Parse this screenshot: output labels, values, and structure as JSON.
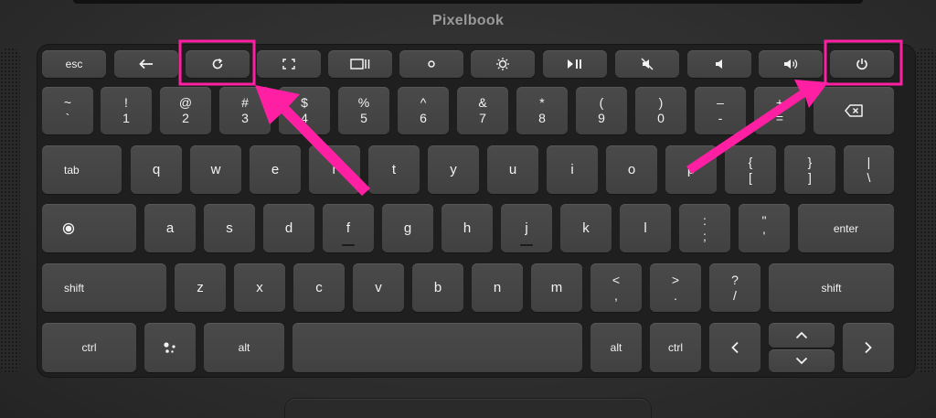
{
  "brand": "Pixelbook",
  "accent_color": "#ff1fa3",
  "icons": {
    "back": "arrow-left-icon",
    "refresh": "refresh-icon",
    "fullscreen": "fullscreen-icon",
    "overview": "window-overview-icon",
    "brightness_down": "brightness-down-icon",
    "brightness_up": "brightness-up-icon",
    "play_pause": "play-pause-icon",
    "mute": "mute-icon",
    "volume_down": "volume-down-icon",
    "volume_up": "volume-up-icon",
    "power": "power-icon",
    "backspace": "backspace-icon",
    "launcher": "launcher-icon",
    "assistant": "assistant-icon"
  },
  "keys": {
    "esc": "esc",
    "tab": "tab",
    "enter": "enter",
    "shift": "shift",
    "ctrl": "ctrl",
    "alt": "alt",
    "number_row": [
      {
        "top": "~",
        "bottom": "`"
      },
      {
        "top": "!",
        "bottom": "1"
      },
      {
        "top": "@",
        "bottom": "2"
      },
      {
        "top": "#",
        "bottom": "3"
      },
      {
        "top": "$",
        "bottom": "4"
      },
      {
        "top": "%",
        "bottom": "5"
      },
      {
        "top": "^",
        "bottom": "6"
      },
      {
        "top": "&",
        "bottom": "7"
      },
      {
        "top": "*",
        "bottom": "8"
      },
      {
        "top": "(",
        "bottom": "9"
      },
      {
        "top": ")",
        "bottom": "0"
      },
      {
        "top": "–",
        "bottom": "-"
      },
      {
        "top": "+",
        "bottom": "="
      }
    ],
    "qwerty_row": [
      "q",
      "w",
      "e",
      "r",
      "t",
      "y",
      "u",
      "i",
      "o",
      "p"
    ],
    "qwerty_symbols": [
      {
        "top": "{",
        "bottom": "["
      },
      {
        "top": "}",
        "bottom": "]"
      },
      {
        "top": "|",
        "bottom": "\\"
      }
    ],
    "home_row": [
      "a",
      "s",
      "d",
      "f",
      "g",
      "h",
      "j",
      "k",
      "l"
    ],
    "home_symbols": [
      {
        "top": ":",
        "bottom": ";"
      },
      {
        "top": "\"",
        "bottom": "'"
      }
    ],
    "bottom_row_letters": [
      "z",
      "x",
      "c",
      "v",
      "b",
      "n",
      "m"
    ],
    "bottom_symbols": [
      {
        "top": "<",
        "bottom": ","
      },
      {
        "top": ">",
        "bottom": "."
      },
      {
        "top": "?",
        "bottom": "/"
      }
    ]
  }
}
